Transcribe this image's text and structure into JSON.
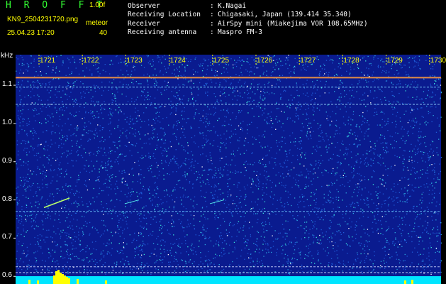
{
  "header": {
    "app_title": "H R O F F T",
    "version": "1.00f",
    "filename": "KN9_2504231720.png",
    "mode": "meteor",
    "datetime": "25.04.23 17:20",
    "threshold": "40"
  },
  "station_info": [
    {
      "key": "Observer",
      "value": "K.Nagai"
    },
    {
      "key": "Receiving Location",
      "value": "Chigasaki, Japan (139.414 35.340)"
    },
    {
      "key": "Receiver",
      "value": "AirSpy mini (Miakejima VOR 108.65MHz)"
    },
    {
      "key": "Receiving antenna",
      "value": "Maspro FM-3"
    }
  ],
  "colors": {
    "background": "#0a1b8f",
    "noise_dots": [
      "#1e5bd8",
      "#2ca7e0",
      "#39e0d8",
      "#ffffff"
    ],
    "label_yellow": "#ffff00",
    "title_green": "#33ff33",
    "bottom_band": "#00e5ff"
  },
  "chart_data": {
    "type": "heatmap",
    "ylabel": "kHz",
    "y_ticks": [
      "1.1",
      "1.0",
      "0.9",
      "0.8",
      "0.7",
      "0.6"
    ],
    "x_ticks": [
      "1721",
      "1722",
      "1723",
      "1724",
      "1725",
      "1726",
      "1727",
      "1728",
      "1729",
      "1730"
    ],
    "ylim": [
      0.58,
      1.18
    ],
    "horizontal_lines_khz": [
      1.12,
      1.095,
      1.05,
      0.77,
      0.625,
      0.61
    ]
  }
}
